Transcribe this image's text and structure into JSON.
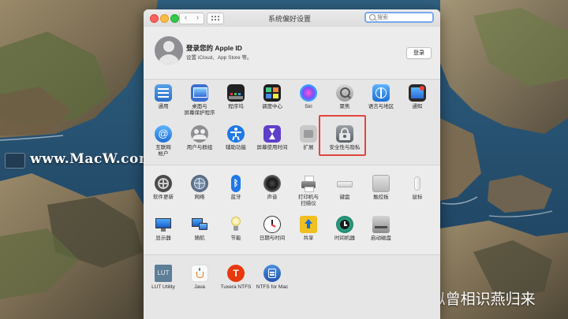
{
  "window": {
    "title": "系统偏好设置",
    "search_placeholder": "搜索",
    "nav_back": "‹",
    "nav_forward": "›"
  },
  "account": {
    "title": "登录您的 Apple ID",
    "subtitle": "设置 iCloud、App Store 等。",
    "login_button": "登录"
  },
  "sections": {
    "personal_row1": [
      {
        "label": "通用",
        "icon": "general-icon"
      },
      {
        "label": "桌面与\n屏幕保护程序",
        "icon": "desktop-screensaver-icon"
      },
      {
        "label": "程序坞",
        "icon": "dock-icon"
      },
      {
        "label": "调度中心",
        "icon": "mission-control-icon"
      },
      {
        "label": "Siri",
        "icon": "siri-icon"
      },
      {
        "label": "聚焦",
        "icon": "spotlight-icon"
      },
      {
        "label": "语言与地区",
        "icon": "language-region-icon"
      },
      {
        "label": "通知",
        "icon": "notifications-icon"
      }
    ],
    "personal_row2": [
      {
        "label": "互联网\n帐户",
        "icon": "internet-accounts-icon"
      },
      {
        "label": "用户与群组",
        "icon": "users-groups-icon"
      },
      {
        "label": "辅助功能",
        "icon": "accessibility-icon"
      },
      {
        "label": "屏幕使用时间",
        "icon": "screen-time-icon"
      },
      {
        "label": "扩展",
        "icon": "extensions-icon"
      },
      {
        "label": "安全性与隐私",
        "icon": "security-privacy-icon"
      }
    ],
    "hardware_row1": [
      {
        "label": "软件更新",
        "icon": "software-update-icon"
      },
      {
        "label": "网络",
        "icon": "network-icon"
      },
      {
        "label": "蓝牙",
        "icon": "bluetooth-icon"
      },
      {
        "label": "声音",
        "icon": "sound-icon"
      },
      {
        "label": "打印机与\n扫描仪",
        "icon": "printers-scanners-icon"
      },
      {
        "label": "键盘",
        "icon": "keyboard-icon"
      },
      {
        "label": "触控板",
        "icon": "trackpad-icon"
      },
      {
        "label": "鼠标",
        "icon": "mouse-icon"
      }
    ],
    "hardware_row2": [
      {
        "label": "显示器",
        "icon": "displays-icon"
      },
      {
        "label": "随航",
        "icon": "sidecar-icon"
      },
      {
        "label": "节能",
        "icon": "energy-saver-icon"
      },
      {
        "label": "日期与时间",
        "icon": "date-time-icon"
      },
      {
        "label": "共享",
        "icon": "sharing-icon"
      },
      {
        "label": "时间机器",
        "icon": "time-machine-icon"
      },
      {
        "label": "启动磁盘",
        "icon": "startup-disk-icon"
      }
    ],
    "other_row": [
      {
        "label": "LUT Utility",
        "icon": "lut-utility-icon",
        "icon_text": "LUT"
      },
      {
        "label": "Java",
        "icon": "java-icon"
      },
      {
        "label": "Tuxera NTFS",
        "icon": "tuxera-ntfs-icon",
        "icon_text": "T"
      },
      {
        "label": "NTFS for Mac",
        "icon": "ntfs-for-mac-icon"
      }
    ]
  },
  "watermarks": {
    "left": "www.MacW.com",
    "right": "知乎 @似曾相识燕归来"
  },
  "colors": {
    "highlight": "#e0453c",
    "search_focus": "#78a9ec"
  }
}
